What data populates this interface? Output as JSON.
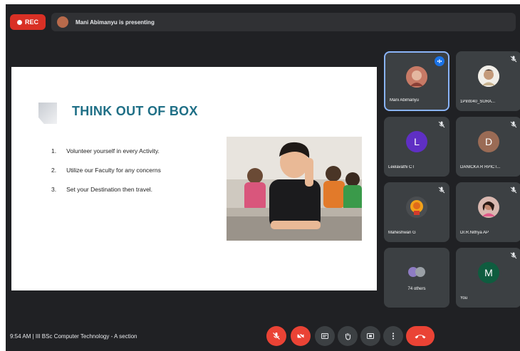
{
  "top_bar": {
    "rec_label": "REC",
    "presenting_text": "Mani Abimanyu is presenting"
  },
  "slide": {
    "title": "THINK OUT OF BOX",
    "items": [
      {
        "num": "1.",
        "text": "Volunteer yourself in every Activity."
      },
      {
        "num": "2.",
        "text": "Utilize our Faculty for any concerns"
      },
      {
        "num": "3.",
        "text": "Set your Destination then travel."
      }
    ]
  },
  "participants": [
    {
      "name": "Mani Abimanyu",
      "avatar": "photo",
      "muted": false,
      "speaking": true
    },
    {
      "name": "1PInt040_SURA...",
      "avatar": "photo",
      "muted": true
    },
    {
      "name": "Leelavathi CT",
      "initial": "L",
      "color": "#5f2fc4",
      "muted": true
    },
    {
      "name": "DANICKA R RPICT...",
      "initial": "D",
      "color": "#9a6b55",
      "muted": true
    },
    {
      "name": "Maheshwari G",
      "avatar": "cartoon",
      "muted": true
    },
    {
      "name": "Dr.R.Nithya AP",
      "avatar": "photo",
      "muted": true
    },
    {
      "name": "74 others",
      "others": true
    },
    {
      "name": "You",
      "initial": "M",
      "color": "#0f5c3f",
      "muted": true
    }
  ],
  "bottom_bar": {
    "time": "9:54 AM",
    "separator": "|",
    "meeting_title": "III BSc Computer Technology - A section"
  },
  "colors": {
    "background": "#202124",
    "tile": "#3c4043",
    "accent_red": "#ea4335",
    "speaking_blue": "#1a73e8",
    "slide_title": "#1f6f86"
  },
  "controls": [
    "mic-off-icon",
    "camera-off-icon",
    "captions-icon",
    "raise-hand-icon",
    "present-screen-icon",
    "more-options-icon",
    "leave-call-icon"
  ]
}
